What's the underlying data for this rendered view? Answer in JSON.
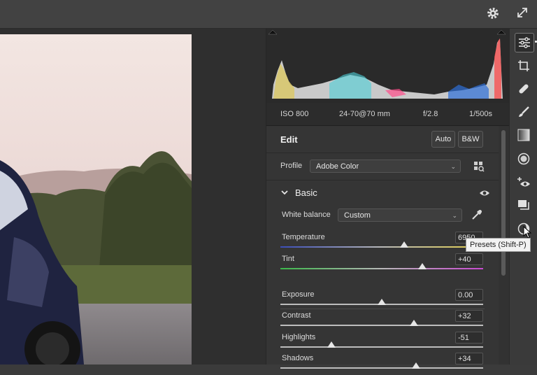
{
  "app": {
    "toolbar": {
      "settings_icon": "gear-icon",
      "expand_icon": "expand-icon"
    }
  },
  "exif": {
    "iso": "ISO 800",
    "lens": "24-70@70 mm",
    "aperture": "f/2.8",
    "shutter": "1/500s"
  },
  "edit": {
    "title": "Edit",
    "auto_label": "Auto",
    "bw_label": "B&W",
    "profile_label": "Profile",
    "profile_value": "Adobe Color"
  },
  "basic": {
    "title": "Basic",
    "white_balance_label": "White balance",
    "white_balance_value": "Custom",
    "sliders": [
      {
        "label": "Temperature",
        "value": "6950",
        "level": 0.61
      },
      {
        "label": "Tint",
        "value": "+40",
        "level": 0.7
      },
      {
        "label": "Exposure",
        "value": "0.00",
        "level": 0.5
      },
      {
        "label": "Contrast",
        "value": "+32",
        "level": 0.66
      },
      {
        "label": "Highlights",
        "value": "-51",
        "level": 0.25
      },
      {
        "label": "Shadows",
        "value": "+34",
        "level": 0.67
      }
    ]
  },
  "rail": {
    "icons": [
      "edit-sliders-icon",
      "crop-icon",
      "healing-icon",
      "brush-icon",
      "linear-gradient-icon",
      "radial-gradient-icon",
      "red-eye-icon",
      "snapshots-icon",
      "presets-icon"
    ]
  },
  "tooltip": {
    "text": "Presets (Shift-P)"
  },
  "colors": {
    "accent": "#2d7ff9",
    "panel": "#353535",
    "canvas": "#2f2f2f"
  }
}
